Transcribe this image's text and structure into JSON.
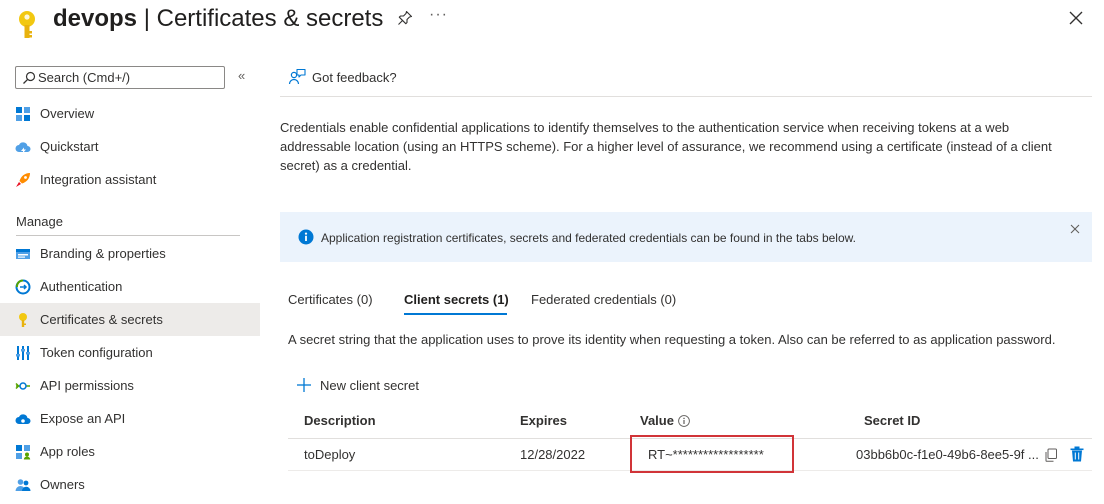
{
  "header": {
    "title_app": "devops",
    "title_sep": " | ",
    "title_page": "Certificates & secrets",
    "more_label": "···"
  },
  "sidebar": {
    "search_placeholder": "Search (Cmd+/)",
    "collapse_label": "«",
    "section_manage": "Manage",
    "items": [
      {
        "label": "Overview",
        "icon": "overview-grid-icon"
      },
      {
        "label": "Quickstart",
        "icon": "quickstart-cloud-icon"
      },
      {
        "label": "Integration assistant",
        "icon": "rocket-icon"
      },
      {
        "label": "Branding & properties",
        "icon": "branding-icon"
      },
      {
        "label": "Authentication",
        "icon": "authentication-icon"
      },
      {
        "label": "Certificates & secrets",
        "icon": "key-icon",
        "active": true
      },
      {
        "label": "Token configuration",
        "icon": "token-config-icon"
      },
      {
        "label": "API permissions",
        "icon": "api-permissions-icon"
      },
      {
        "label": "Expose an API",
        "icon": "expose-api-cloud-icon"
      },
      {
        "label": "App roles",
        "icon": "app-roles-icon"
      },
      {
        "label": "Owners",
        "icon": "owners-icon"
      }
    ]
  },
  "main": {
    "feedback_label": "Got feedback?",
    "description": "Credentials enable confidential applications to identify themselves to the authentication service when receiving tokens at a web addressable location (using an HTTPS scheme). For a higher level of assurance, we recommend using a certificate (instead of a client secret) as a credential.",
    "info_message": "Application registration certificates, secrets and federated credentials can be found in the tabs below.",
    "tabs": [
      {
        "label": "Certificates (0)"
      },
      {
        "label": "Client secrets (1)",
        "active": true
      },
      {
        "label": "Federated credentials (0)"
      }
    ],
    "secret_description": "A secret string that the application uses to prove its identity when requesting a token. Also can be referred to as application password.",
    "new_secret_label": "New client secret",
    "table": {
      "headers": {
        "description": "Description",
        "expires": "Expires",
        "value": "Value",
        "secret_id": "Secret ID"
      },
      "rows": [
        {
          "description": "toDeploy",
          "expires": "12/28/2022",
          "value": "RT~******************",
          "secret_id": "03bb6b0c-f1e0-49b6-8ee5-9f ..."
        }
      ]
    }
  },
  "colors": {
    "accent": "#0078d4",
    "highlight": "#d13438",
    "info_bg": "#ebf3fc",
    "active_nav_bg": "#edebe9",
    "key_gold": "#f2c811"
  }
}
